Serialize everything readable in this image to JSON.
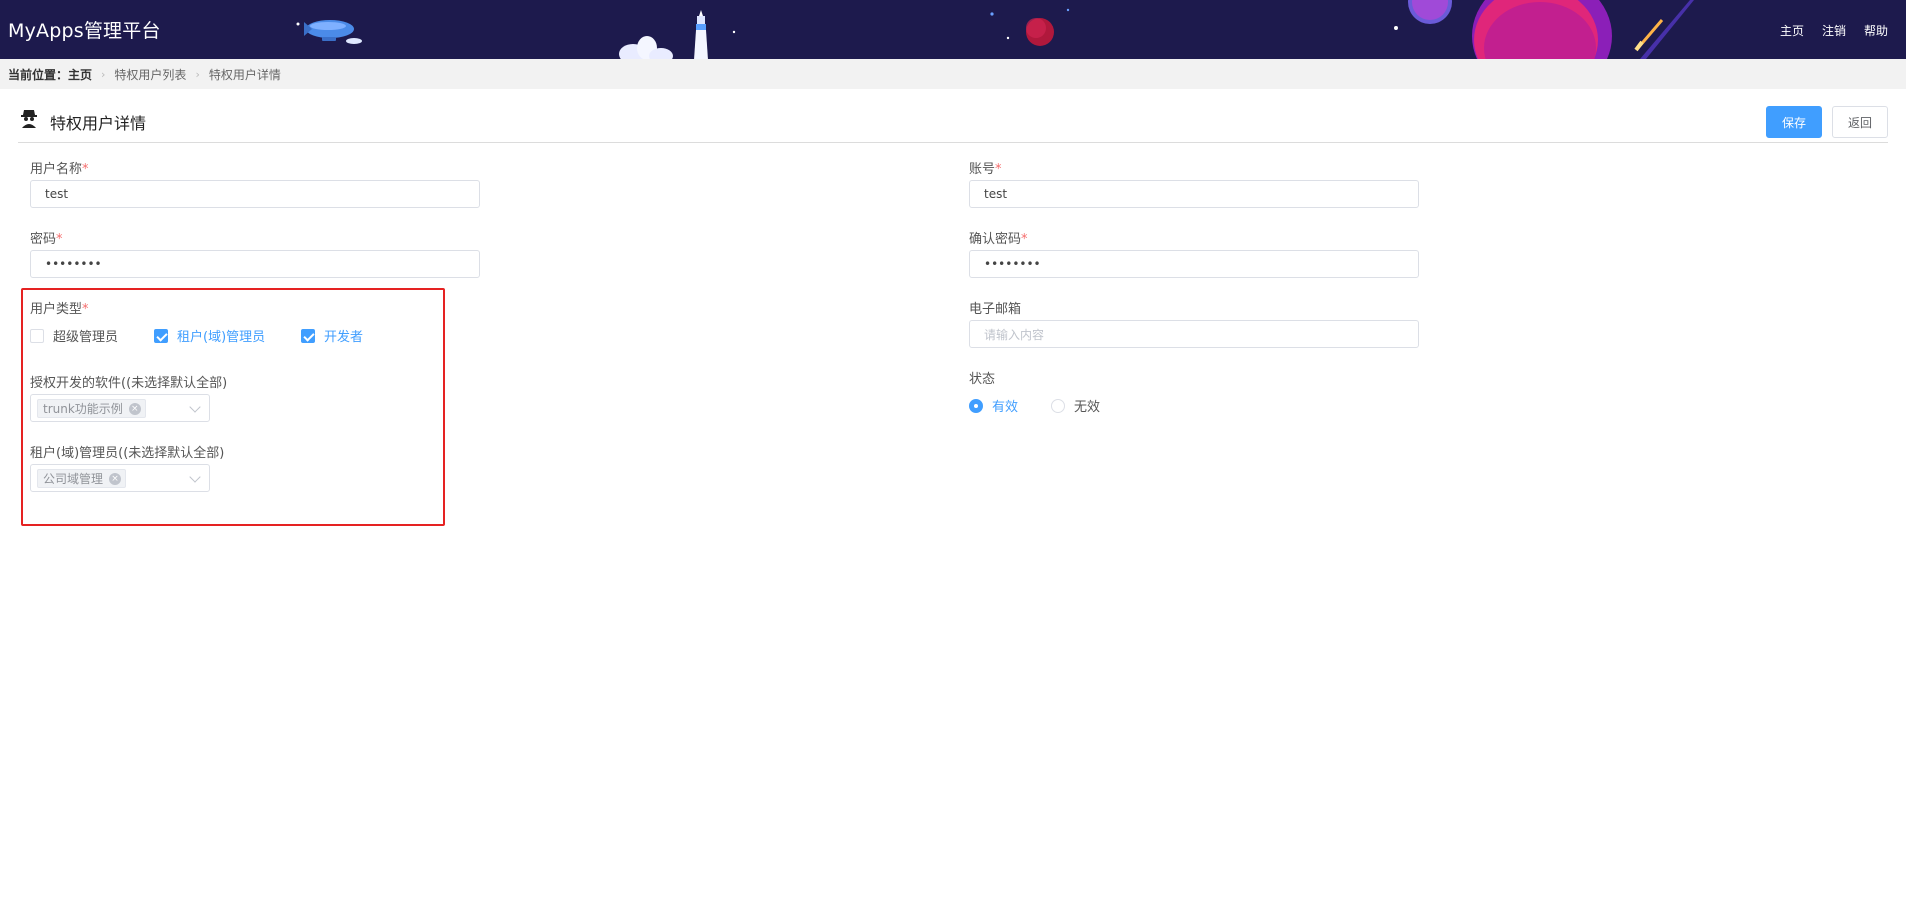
{
  "header": {
    "app_title": "MyApps管理平台",
    "nav": [
      "主页",
      "注销",
      "帮助"
    ]
  },
  "breadcrumb": {
    "lead": "当前位置：主页",
    "items": [
      "特权用户列表",
      "特权用户详情"
    ]
  },
  "page": {
    "title": "特权用户详情",
    "icon": "spy-user-icon",
    "save_label": "保存",
    "back_label": "返回"
  },
  "form": {
    "username": {
      "label": "用户名称",
      "value": "test"
    },
    "account": {
      "label": "账号",
      "value": "test"
    },
    "password": {
      "label": "密码",
      "value": "••••••••"
    },
    "confirm_password": {
      "label": "确认密码",
      "value": "••••••••"
    },
    "email": {
      "label": "电子邮箱",
      "placeholder": "请输入内容"
    },
    "user_type": {
      "label": "用户类型",
      "options": [
        {
          "label": "超级管理员",
          "checked": false
        },
        {
          "label": "租户(域)管理员",
          "checked": true
        },
        {
          "label": "开发者",
          "checked": true
        }
      ]
    },
    "authorized_software": {
      "label": "授权开发的软件((未选择默认全部)",
      "tags": [
        "trunk功能示例"
      ]
    },
    "tenant_admin": {
      "label": "租户(域)管理员((未选择默认全部)",
      "tags": [
        "公司域管理"
      ]
    },
    "status": {
      "label": "状态",
      "options": [
        {
          "label": "有效",
          "selected": true
        },
        {
          "label": "无效",
          "selected": false
        }
      ]
    }
  },
  "colors": {
    "header_bg": "#1d1a4d",
    "accent": "#409eff",
    "required": "#f56c6c",
    "highlight_box": "#e52222"
  }
}
